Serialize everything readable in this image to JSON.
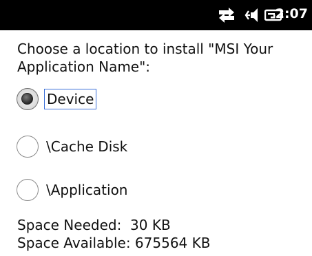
{
  "status_bar": {
    "time": "2:07",
    "icons": [
      "connectivity-icon",
      "speaker-icon",
      "battery-icon"
    ]
  },
  "prompt": "Choose a location to install \"MSI Your Application Name\":",
  "options": [
    {
      "label": "Device",
      "selected": true
    },
    {
      "label": "\\Cache Disk",
      "selected": false
    },
    {
      "label": "\\Application",
      "selected": false
    }
  ],
  "space_needed": "Space Needed:  30 KB",
  "space_available": "Space Available: 675564 KB"
}
